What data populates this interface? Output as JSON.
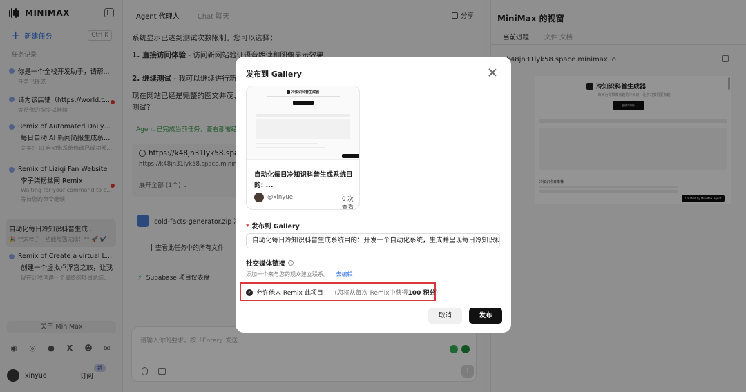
{
  "sidebar": {
    "brand": "MINIMAX",
    "new_task": "新建任务",
    "new_task_shortcut": "Ctrl K",
    "history_title": "任务记录",
    "tasks": [
      {
        "title": "你是一个全栈开发助手，请帮...",
        "status": "任务已提成"
      },
      {
        "title": "请为该店铺（https://world.t...",
        "status": "等待你的指令以继续"
      },
      {
        "title": "Remix of Automated Daily A...",
        "subtitle": "每日自动 AI 新闻简报生成系统的",
        "status": "完美！ ☑ 自动化系统修改已成功部署！"
      },
      {
        "title": "Remix of Liziqi Fan Website",
        "subtitle": "李子柒粉丝网 Remix",
        "status": "Waiting for your command to continue",
        "status2": "等待您的命令继续"
      },
      {
        "title": "自动化每日冷知识科普生成 ...",
        "status": "🎉 **太棒了！功能增强完成！** 🚀 ✔️"
      },
      {
        "title": "Remix of Create a virtual Lo...",
        "subtitle": "创建一个虚拟卢浮宫之旅，让我",
        "status": "现在让我创建一个最终的项目总结报告，..."
      }
    ],
    "about": "关于 MiniMax",
    "user_name": "xinyue",
    "subscribe": "订阅",
    "badge": "新"
  },
  "chat": {
    "tab_agent": "Agent  代理人",
    "tab_chat": "Chat  聊天",
    "share": "分享",
    "msg_intro": "系统显示已达到测试次数限制。您可以选择：",
    "item1_bold": "1. 直接访问体验",
    "item1_rest": " - 访问新网站验证语音朗读和图像显示效果",
    "item2_bold": "2. 继续测试",
    "item2_rest": " - 我可以继续进行新增",
    "msg_line3": "现在网站已经是完整的图文并茂、",
    "msg_line4": "测试?",
    "agent_note": "Agent 已完成当前任务，查看部署结果",
    "link_title": "https://k48jn31lyk58.space.mi",
    "link_sub": "https://k48jn31lyk58.space.minimax.io",
    "expand": "展开全部 (1个) ⌄",
    "file_name": "cold-facts-generator.zip  冷事",
    "view_files": "查看此任务中的所有文件",
    "supabase": "Supabase 项目仪表盘",
    "composer_placeholder": "请输入你的要求，按「Enter」发送"
  },
  "preview": {
    "title": "MiniMax 的视窗",
    "tab_current": "当前进程",
    "tab_files": "文件  文档",
    "url": "://k48jn31lyk58.space.minimax.io",
    "site_title": "冷知识科普生成器",
    "site_desc": "每天为你推荐有趣的冷知识，让学习变得更有趣",
    "site_button": "生成冷知识",
    "site_heading": "冷知识今日推荐",
    "made_with": "Created by MiniMax Agent"
  },
  "modal": {
    "title": "发布到 Gallery",
    "card_title": "自动化每日冷知识科普生成系统目的: ...",
    "card_user": "@xinyue",
    "card_views": "0 次查看",
    "thumb_title": "冷知识科普生成器",
    "publish_label": "发布到 Gallery",
    "publish_required": "*",
    "publish_value": "自动化每日冷知识科普生成系统目的：开发一个自动化系统，生成并呈现每日冷知识科普。",
    "social_label": "社交媒体链接",
    "social_hint": "添加一个来与您的观众建立联系。",
    "social_edit": "去编辑",
    "remix_label": "允许他人 Remix 此项目",
    "remix_note_prefix": "（您将从每次 Remix中获得",
    "remix_points": "100 积分",
    "remix_note_suffix": "）",
    "cancel": "取消",
    "publish": "发布"
  }
}
